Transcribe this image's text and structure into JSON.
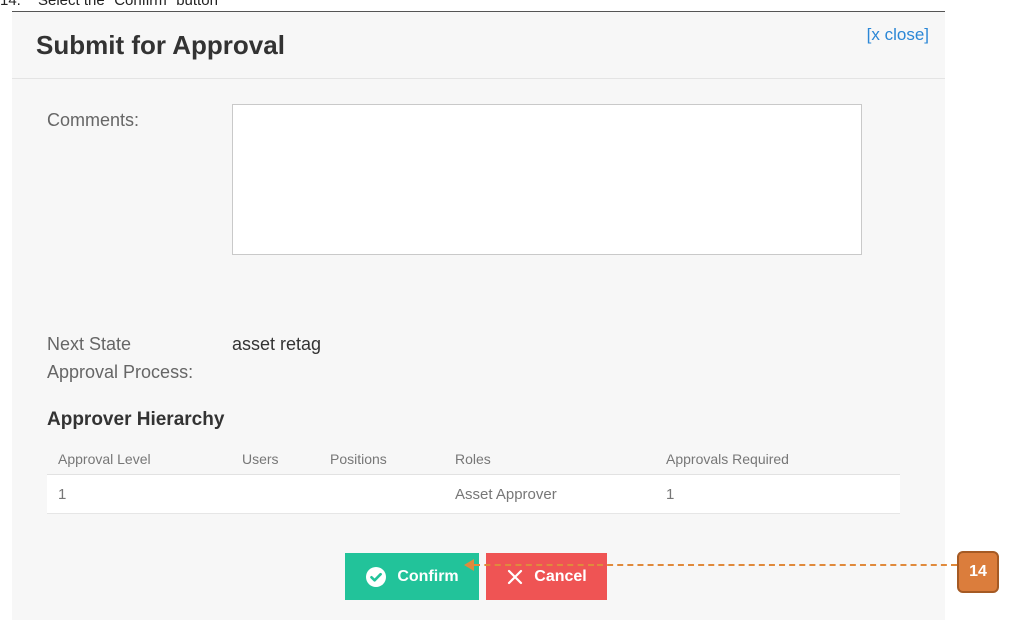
{
  "instruction": {
    "number": "14.",
    "text": "Select the \"Confirm\" button"
  },
  "modal": {
    "title": "Submit for Approval",
    "close_label": "[x close]",
    "comments_label": "Comments:",
    "comments_value": "",
    "next_state_label_line1": "Next State",
    "next_state_label_line2": "Approval Process:",
    "next_state_value": "asset retag",
    "hierarchy_title": "Approver Hierarchy",
    "table": {
      "headers": [
        "Approval Level",
        "Users",
        "Positions",
        "Roles",
        "Approvals Required"
      ],
      "rows": [
        [
          "1",
          "",
          "",
          "Asset Approver",
          "1"
        ]
      ]
    },
    "confirm_label": "Confirm",
    "cancel_label": "Cancel"
  },
  "callout": {
    "number": "14"
  },
  "colors": {
    "confirm": "#22c39a",
    "cancel": "#ef5454",
    "callout": "#db7d3c",
    "link": "#2b87d6"
  }
}
